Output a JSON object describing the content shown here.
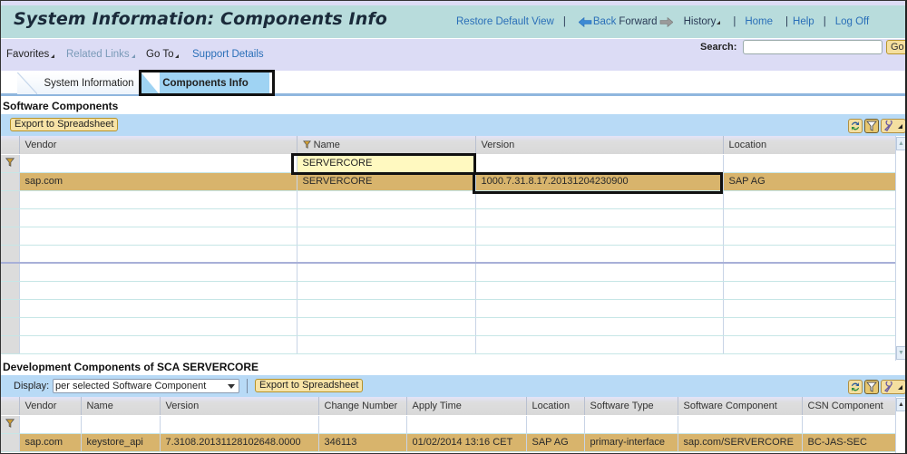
{
  "header": {
    "title": "System Information: Components Info",
    "links": {
      "restore_default_view": "Restore Default View",
      "back": "Back",
      "forward": "Forward",
      "history": "History",
      "home": "Home",
      "help": "Help",
      "log_off": "Log Off",
      "separator": "|"
    }
  },
  "nav": {
    "menus": [
      {
        "label": "Favorites",
        "enabled": true
      },
      {
        "label": "Related Links",
        "enabled": false
      },
      {
        "label": "Go To",
        "enabled": true
      },
      {
        "label": "Support Details",
        "enabled": true
      }
    ],
    "search": {
      "label": "Search:",
      "value": "",
      "go_label": "Go"
    }
  },
  "tabs": [
    {
      "label": "System Information",
      "active": false
    },
    {
      "label": "Components Info",
      "active": true
    }
  ],
  "software_components": {
    "title": "Software Components",
    "export_label": "Export to Spreadsheet",
    "columns": [
      "Vendor",
      "Name",
      "Version",
      "Location"
    ],
    "filter": {
      "Vendor": "",
      "Name": "SERVERCORE",
      "Version": "",
      "Location": ""
    },
    "rows": [
      {
        "vendor": "sap.com",
        "name": "SERVERCORE",
        "version": "1000.7.31.8.17.20131204230900",
        "location": "SAP AG",
        "selected": true
      }
    ],
    "empty_rows": 9
  },
  "development_components": {
    "title": "Development Components of SCA SERVERCORE",
    "display_label": "Display:",
    "display_value": "per selected Software Component",
    "export_label": "Export to Spreadsheet",
    "columns": [
      "Vendor",
      "Name",
      "Version",
      "Change Number",
      "Apply Time",
      "Location",
      "Software Type",
      "Software Component",
      "CSN Component"
    ],
    "rows": [
      {
        "vendor": "sap.com",
        "name": "keystore_api",
        "version": "7.3108.20131128102648.0000",
        "change_number": "346113",
        "apply_time": "01/02/2014 13:16 CET",
        "location": "SAP AG",
        "software_type": "primary-interface",
        "software_component": "sap.com/SERVERCORE",
        "csn_component": "BC-JAS-SEC",
        "selected": true
      }
    ]
  },
  "icons": {
    "refresh": "refresh-icon",
    "filter": "filter-icon",
    "settings": "wrench-settings-icon"
  }
}
